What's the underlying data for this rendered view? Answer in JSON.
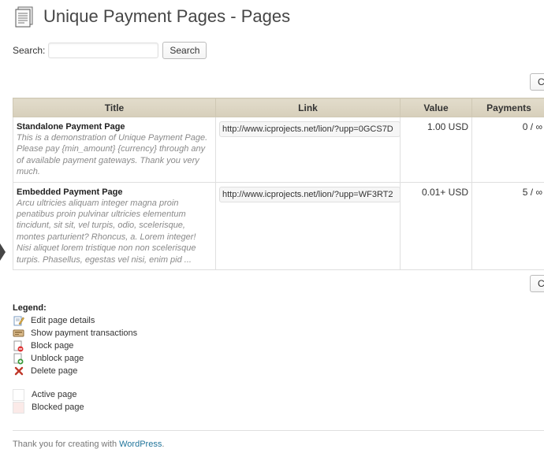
{
  "header": {
    "title": "Unique Payment Pages - Pages",
    "icon": "pages-icon"
  },
  "search": {
    "label": "Search:",
    "value": "",
    "button": "Search"
  },
  "edge_button": {
    "label": "C"
  },
  "table": {
    "headers": [
      "Title",
      "Link",
      "Value",
      "Payments"
    ],
    "rows": [
      {
        "name": "Standalone Payment Page",
        "description": "This is a demonstration of Unique Payment Page. Please pay {min_amount} {currency} through any of available payment gateways. Thank you very much.",
        "link": "http://www.icprojects.net/lion/?upp=0GCS7D",
        "value": "1.00 USD",
        "payments": "0 / ∞"
      },
      {
        "name": "Embedded Payment Page",
        "description": "Arcu ultricies aliquam integer magna proin penatibus proin pulvinar ultricies elementum tincidunt, sit sit, vel turpis, odio, scelerisque, montes parturient? Rhoncus, a. Lorem integer! Nisi aliquet lorem tristique non non scelerisque turpis. Phasellus, egestas vel nisi, enim pid ...",
        "link": "http://www.icprojects.net/lion/?upp=WF3RT2",
        "value": "0.01+ USD",
        "payments": "5 / ∞"
      }
    ]
  },
  "legend": {
    "title": "Legend:",
    "icons": [
      {
        "icon": "edit-icon",
        "label": "Edit page details"
      },
      {
        "icon": "transactions-icon",
        "label": "Show payment transactions"
      },
      {
        "icon": "block-icon",
        "label": "Block page"
      },
      {
        "icon": "unblock-icon",
        "label": "Unblock page"
      },
      {
        "icon": "delete-icon",
        "label": "Delete page"
      }
    ],
    "states": [
      {
        "label": "Active page",
        "color": "#ffffff"
      },
      {
        "label": "Blocked page",
        "color": "#fbeae8"
      }
    ]
  },
  "footer": {
    "text": "Thank you for creating with ",
    "link": "WordPress",
    "suffix": "."
  },
  "colors": {
    "header_bg": "#e2dccb",
    "link": "#21759b",
    "delete": "#c0392b"
  }
}
